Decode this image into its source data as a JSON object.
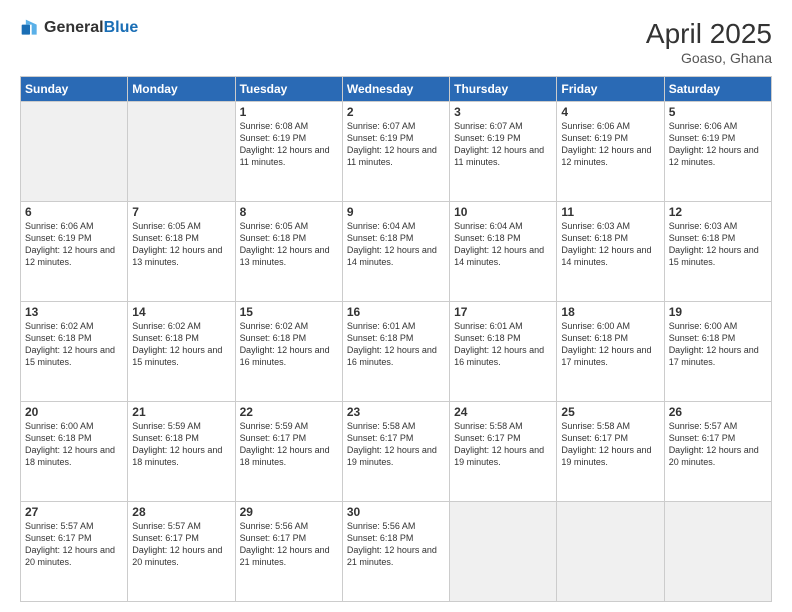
{
  "header": {
    "logo_general": "General",
    "logo_blue": "Blue",
    "month_year": "April 2025",
    "location": "Goaso, Ghana"
  },
  "weekdays": [
    "Sunday",
    "Monday",
    "Tuesday",
    "Wednesday",
    "Thursday",
    "Friday",
    "Saturday"
  ],
  "weeks": [
    [
      {
        "day": "",
        "info": ""
      },
      {
        "day": "",
        "info": ""
      },
      {
        "day": "1",
        "info": "Sunrise: 6:08 AM\nSunset: 6:19 PM\nDaylight: 12 hours and 11 minutes."
      },
      {
        "day": "2",
        "info": "Sunrise: 6:07 AM\nSunset: 6:19 PM\nDaylight: 12 hours and 11 minutes."
      },
      {
        "day": "3",
        "info": "Sunrise: 6:07 AM\nSunset: 6:19 PM\nDaylight: 12 hours and 11 minutes."
      },
      {
        "day": "4",
        "info": "Sunrise: 6:06 AM\nSunset: 6:19 PM\nDaylight: 12 hours and 12 minutes."
      },
      {
        "day": "5",
        "info": "Sunrise: 6:06 AM\nSunset: 6:19 PM\nDaylight: 12 hours and 12 minutes."
      }
    ],
    [
      {
        "day": "6",
        "info": "Sunrise: 6:06 AM\nSunset: 6:19 PM\nDaylight: 12 hours and 12 minutes."
      },
      {
        "day": "7",
        "info": "Sunrise: 6:05 AM\nSunset: 6:18 PM\nDaylight: 12 hours and 13 minutes."
      },
      {
        "day": "8",
        "info": "Sunrise: 6:05 AM\nSunset: 6:18 PM\nDaylight: 12 hours and 13 minutes."
      },
      {
        "day": "9",
        "info": "Sunrise: 6:04 AM\nSunset: 6:18 PM\nDaylight: 12 hours and 14 minutes."
      },
      {
        "day": "10",
        "info": "Sunrise: 6:04 AM\nSunset: 6:18 PM\nDaylight: 12 hours and 14 minutes."
      },
      {
        "day": "11",
        "info": "Sunrise: 6:03 AM\nSunset: 6:18 PM\nDaylight: 12 hours and 14 minutes."
      },
      {
        "day": "12",
        "info": "Sunrise: 6:03 AM\nSunset: 6:18 PM\nDaylight: 12 hours and 15 minutes."
      }
    ],
    [
      {
        "day": "13",
        "info": "Sunrise: 6:02 AM\nSunset: 6:18 PM\nDaylight: 12 hours and 15 minutes."
      },
      {
        "day": "14",
        "info": "Sunrise: 6:02 AM\nSunset: 6:18 PM\nDaylight: 12 hours and 15 minutes."
      },
      {
        "day": "15",
        "info": "Sunrise: 6:02 AM\nSunset: 6:18 PM\nDaylight: 12 hours and 16 minutes."
      },
      {
        "day": "16",
        "info": "Sunrise: 6:01 AM\nSunset: 6:18 PM\nDaylight: 12 hours and 16 minutes."
      },
      {
        "day": "17",
        "info": "Sunrise: 6:01 AM\nSunset: 6:18 PM\nDaylight: 12 hours and 16 minutes."
      },
      {
        "day": "18",
        "info": "Sunrise: 6:00 AM\nSunset: 6:18 PM\nDaylight: 12 hours and 17 minutes."
      },
      {
        "day": "19",
        "info": "Sunrise: 6:00 AM\nSunset: 6:18 PM\nDaylight: 12 hours and 17 minutes."
      }
    ],
    [
      {
        "day": "20",
        "info": "Sunrise: 6:00 AM\nSunset: 6:18 PM\nDaylight: 12 hours and 18 minutes."
      },
      {
        "day": "21",
        "info": "Sunrise: 5:59 AM\nSunset: 6:18 PM\nDaylight: 12 hours and 18 minutes."
      },
      {
        "day": "22",
        "info": "Sunrise: 5:59 AM\nSunset: 6:17 PM\nDaylight: 12 hours and 18 minutes."
      },
      {
        "day": "23",
        "info": "Sunrise: 5:58 AM\nSunset: 6:17 PM\nDaylight: 12 hours and 19 minutes."
      },
      {
        "day": "24",
        "info": "Sunrise: 5:58 AM\nSunset: 6:17 PM\nDaylight: 12 hours and 19 minutes."
      },
      {
        "day": "25",
        "info": "Sunrise: 5:58 AM\nSunset: 6:17 PM\nDaylight: 12 hours and 19 minutes."
      },
      {
        "day": "26",
        "info": "Sunrise: 5:57 AM\nSunset: 6:17 PM\nDaylight: 12 hours and 20 minutes."
      }
    ],
    [
      {
        "day": "27",
        "info": "Sunrise: 5:57 AM\nSunset: 6:17 PM\nDaylight: 12 hours and 20 minutes."
      },
      {
        "day": "28",
        "info": "Sunrise: 5:57 AM\nSunset: 6:17 PM\nDaylight: 12 hours and 20 minutes."
      },
      {
        "day": "29",
        "info": "Sunrise: 5:56 AM\nSunset: 6:17 PM\nDaylight: 12 hours and 21 minutes."
      },
      {
        "day": "30",
        "info": "Sunrise: 5:56 AM\nSunset: 6:18 PM\nDaylight: 12 hours and 21 minutes."
      },
      {
        "day": "",
        "info": ""
      },
      {
        "day": "",
        "info": ""
      },
      {
        "day": "",
        "info": ""
      }
    ]
  ]
}
